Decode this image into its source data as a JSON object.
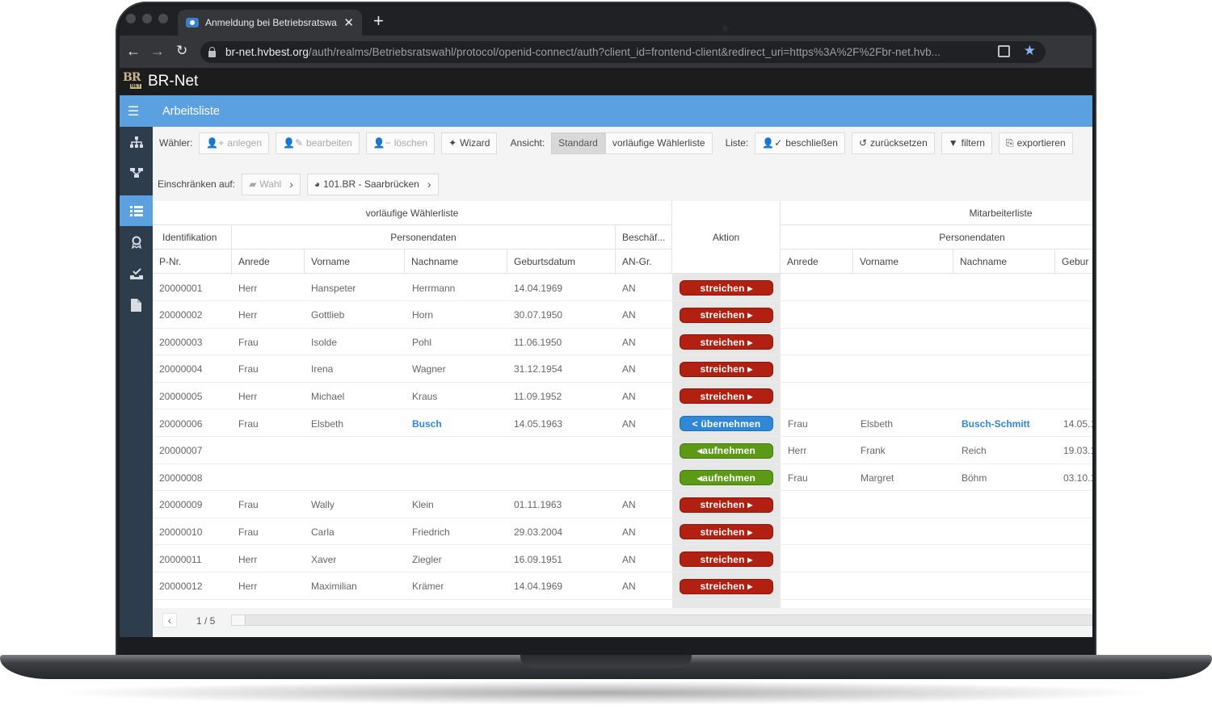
{
  "browser": {
    "tab_title": "Anmeldung bei Betriebsratswa",
    "url_host": "br-net.hvbest.org",
    "url_path": "/auth/realms/Betriebsratswahl/protocol/openid-connect/auth?client_id=frontend-client&redirect_uri=https%3A%2F%2Fbr-net.hvb..."
  },
  "app": {
    "logo_text": "BR",
    "logo_sub": "NET",
    "name": "BR-Net",
    "page_title": "Arbeitsliste"
  },
  "sidebar": {
    "icons": [
      "sitemap-icon",
      "workflow-icon",
      "list-icon",
      "award-icon",
      "inbox-check-icon",
      "document-icon"
    ],
    "active_index": 2
  },
  "toolbar": {
    "waehler_label": "Wähler:",
    "anlegen": "anlegen",
    "bearbeiten": "bearbeiten",
    "loeschen": "löschen",
    "wizard": "Wizard",
    "ansicht_label": "Ansicht:",
    "standard": "Standard",
    "vorlaeufige": "vorläufige Wählerliste",
    "liste_label": "Liste:",
    "beschliessen": "beschließen",
    "zuruecksetzen": "zurücksetzen",
    "filtern": "filtern",
    "exportieren": "exportieren"
  },
  "filter": {
    "label": "Einschränken auf:",
    "wahl": "Wahl",
    "unit": "101.BR - Saarbrücken"
  },
  "table": {
    "group_left": "vorläufige Wählerliste",
    "group_right": "Mitarbeiterliste",
    "aktion": "Aktion",
    "sub_identifikation": "Identifikation",
    "sub_personendaten": "Personendaten",
    "sub_beschaeftigung": "Beschäf...",
    "sub_personendaten_right": "Personendaten",
    "cols_left": [
      "P-Nr.",
      "Anrede",
      "Vorname",
      "Nachname",
      "Geburtsdatum",
      "AN-Gr."
    ],
    "cols_right": [
      "Anrede",
      "Vorname",
      "Nachname",
      "Gebur"
    ],
    "rows": [
      {
        "pnr": "20000001",
        "anrede": "Herr",
        "vorname": "Hanspeter",
        "nachname": "Herrmann",
        "geb": "14.04.1969",
        "angr": "AN",
        "action": "streichen ▸",
        "kind": "strike",
        "r_anrede": "",
        "r_vorname": "",
        "r_nachname": "",
        "r_geb": ""
      },
      {
        "pnr": "20000002",
        "anrede": "Herr",
        "vorname": "Gottlieb",
        "nachname": "Horn",
        "geb": "30.07.1950",
        "angr": "AN",
        "action": "streichen ▸",
        "kind": "strike",
        "r_anrede": "",
        "r_vorname": "",
        "r_nachname": "",
        "r_geb": ""
      },
      {
        "pnr": "20000003",
        "anrede": "Frau",
        "vorname": "Isolde",
        "nachname": "Pohl",
        "geb": "11.06.1950",
        "angr": "AN",
        "action": "streichen ▸",
        "kind": "strike",
        "r_anrede": "",
        "r_vorname": "",
        "r_nachname": "",
        "r_geb": ""
      },
      {
        "pnr": "20000004",
        "anrede": "Frau",
        "vorname": "Irena",
        "nachname": "Wagner",
        "geb": "31.12.1954",
        "angr": "AN",
        "action": "streichen ▸",
        "kind": "strike",
        "r_anrede": "",
        "r_vorname": "",
        "r_nachname": "",
        "r_geb": ""
      },
      {
        "pnr": "20000005",
        "anrede": "Herr",
        "vorname": "Michael",
        "nachname": "Kraus",
        "geb": "11.09.1952",
        "angr": "AN",
        "action": "streichen ▸",
        "kind": "strike",
        "r_anrede": "",
        "r_vorname": "",
        "r_nachname": "",
        "r_geb": ""
      },
      {
        "pnr": "20000006",
        "anrede": "Frau",
        "vorname": "Elsbeth",
        "nachname": "Busch",
        "geb": "14.05.1963",
        "angr": "AN",
        "action": "< übernehmen",
        "kind": "take",
        "r_anrede": "Frau",
        "r_vorname": "Elsbeth",
        "r_nachname": "Busch-Schmitt",
        "r_geb": "14.05.1"
      },
      {
        "pnr": "20000007",
        "anrede": "",
        "vorname": "",
        "nachname": "",
        "geb": "",
        "angr": "",
        "action": "◂aufnehmen",
        "kind": "add",
        "r_anrede": "Herr",
        "r_vorname": "Frank",
        "r_nachname": "Reich",
        "r_geb": "19.03.1"
      },
      {
        "pnr": "20000008",
        "anrede": "",
        "vorname": "",
        "nachname": "",
        "geb": "",
        "angr": "",
        "action": "◂aufnehmen",
        "kind": "add",
        "r_anrede": "Frau",
        "r_vorname": "Margret",
        "r_nachname": "Böhm",
        "r_geb": "03.10.1"
      },
      {
        "pnr": "20000009",
        "anrede": "Frau",
        "vorname": "Wally",
        "nachname": "Klein",
        "geb": "01.11.1963",
        "angr": "AN",
        "action": "streichen ▸",
        "kind": "strike",
        "r_anrede": "",
        "r_vorname": "",
        "r_nachname": "",
        "r_geb": ""
      },
      {
        "pnr": "20000010",
        "anrede": "Frau",
        "vorname": "Carla",
        "nachname": "Friedrich",
        "geb": "29.03.2004",
        "angr": "AN",
        "action": "streichen ▸",
        "kind": "strike",
        "r_anrede": "",
        "r_vorname": "",
        "r_nachname": "",
        "r_geb": ""
      },
      {
        "pnr": "20000011",
        "anrede": "Herr",
        "vorname": "Xaver",
        "nachname": "Ziegler",
        "geb": "16.09.1951",
        "angr": "AN",
        "action": "streichen ▸",
        "kind": "strike",
        "r_anrede": "",
        "r_vorname": "",
        "r_nachname": "",
        "r_geb": ""
      },
      {
        "pnr": "20000012",
        "anrede": "Herr",
        "vorname": "Maximilian",
        "nachname": "Krämer",
        "geb": "14.04.1969",
        "angr": "AN",
        "action": "streichen ▸",
        "kind": "strike",
        "r_anrede": "",
        "r_vorname": "",
        "r_nachname": "",
        "r_geb": ""
      }
    ]
  },
  "pager": {
    "page": "1 / 5"
  },
  "colors": {
    "accent": "#5ba1e0",
    "sidebar": "#2e3d4b",
    "strike": "#b12010",
    "take": "#2f87d6",
    "add": "#5c9a16",
    "highlight_text": "#2e86de"
  }
}
